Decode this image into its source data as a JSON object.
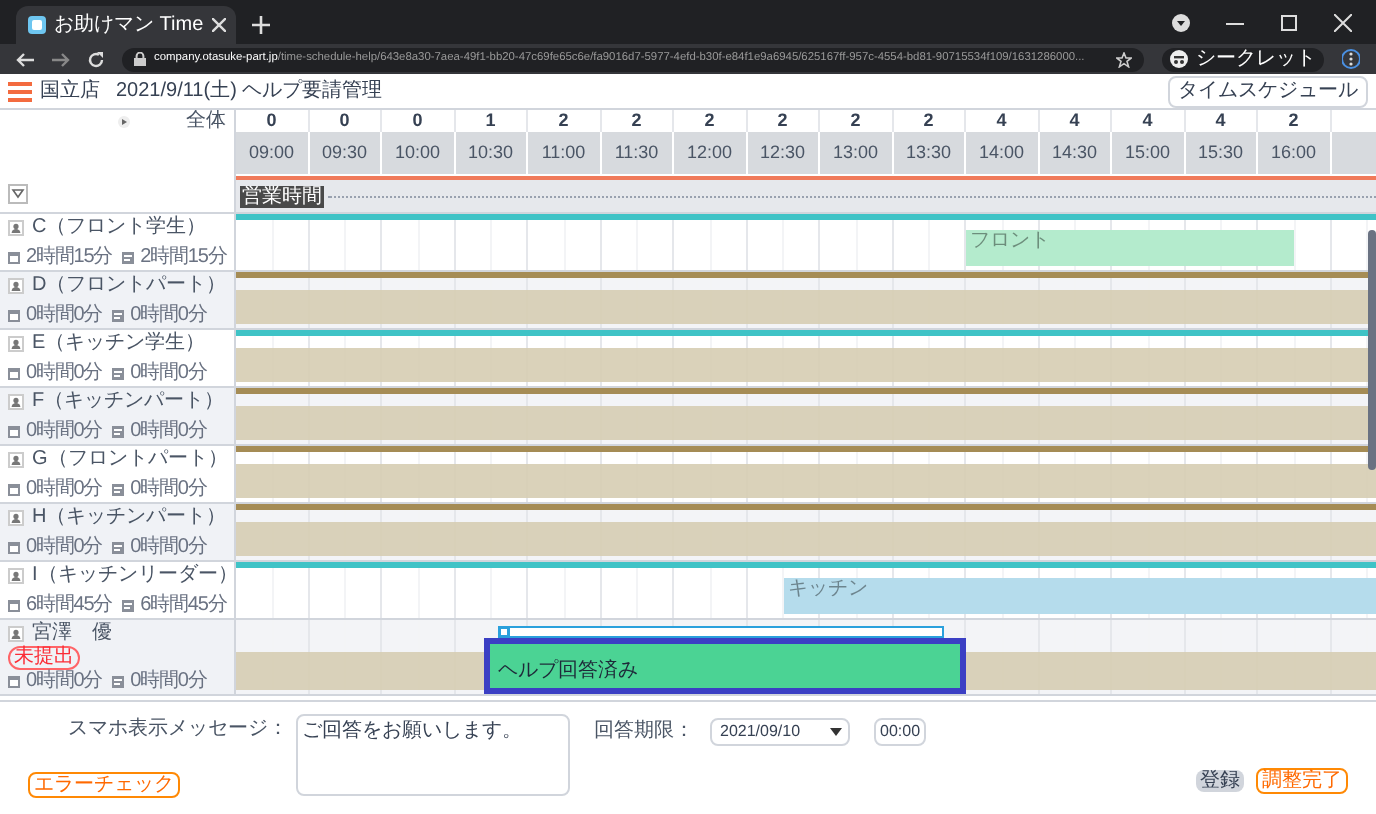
{
  "browser": {
    "tab_title": "お助けマン Time",
    "url_host": "company.otasuke-part.jp",
    "url_path": "/time-schedule-help/643e8a30-7aea-49f1-bb20-47c69fe65c6e/fa9016d7-5977-4efd-b30f-e84f1e9a6945/625167ff-957c-4554-bd81-90715534f109/1631286000...",
    "profile": "シークレット"
  },
  "header": {
    "store": "国立店",
    "title": "2021/9/11(土) ヘルプ要請管理",
    "button": "タイムスケジュール"
  },
  "timeline": {
    "all_label": "全体",
    "band_label": "営業時間",
    "columns": [
      {
        "count": "0",
        "time": "09:00"
      },
      {
        "count": "0",
        "time": "09:30"
      },
      {
        "count": "0",
        "time": "10:00"
      },
      {
        "count": "1",
        "time": "10:30"
      },
      {
        "count": "2",
        "time": "11:00"
      },
      {
        "count": "2",
        "time": "11:30"
      },
      {
        "count": "2",
        "time": "12:00"
      },
      {
        "count": "2",
        "time": "12:30"
      },
      {
        "count": "2",
        "time": "13:00"
      },
      {
        "count": "2",
        "time": "13:30"
      },
      {
        "count": "4",
        "time": "14:00"
      },
      {
        "count": "4",
        "time": "14:30"
      },
      {
        "count": "4",
        "time": "15:00"
      },
      {
        "count": "4",
        "time": "15:30"
      },
      {
        "count": "2",
        "time": "16:00"
      }
    ]
  },
  "staff": [
    {
      "name": "C（フロント学生）",
      "stat_1": "2時間15分",
      "stat_2": "2時間15分",
      "color": "#3fc3c6",
      "band": false,
      "blocks": [
        {
          "label": "フロント",
          "color": "#b4ebcd"
        }
      ]
    },
    {
      "name": "D（フロントパート）",
      "stat_1": "0時間0分",
      "stat_2": "0時間0分",
      "color": "#a58c55",
      "band": true
    },
    {
      "name": "E（キッチン学生）",
      "stat_1": "0時間0分",
      "stat_2": "0時間0分",
      "color": "#3fc3c6",
      "band": true
    },
    {
      "name": "F（キッチンパート）",
      "stat_1": "0時間0分",
      "stat_2": "0時間0分",
      "color": "#a58c55",
      "band": true
    },
    {
      "name": "G（フロントパート）",
      "stat_1": "0時間0分",
      "stat_2": "0時間0分",
      "color": "#a58c55",
      "band": true
    },
    {
      "name": "H（キッチンパート）",
      "stat_1": "0時間0分",
      "stat_2": "0時間0分",
      "color": "#a58c55",
      "band": true
    },
    {
      "name": "I（キッチンリーダー）",
      "stat_1": "6時間45分",
      "stat_2": "6時間45分",
      "color": "#3fc3c6",
      "band": false,
      "blocks": [
        {
          "label": "キッチン",
          "color": "#b5dcec"
        }
      ]
    },
    {
      "name": "宮澤　優",
      "badge": "未提出",
      "stat_1": "0時間0分",
      "stat_2": "0時間0分",
      "band": true,
      "help": {
        "label": "ヘルプ回答済み"
      }
    }
  ],
  "form": {
    "message_label": "スマホ表示メッセージ：",
    "message": "ご回答をお願いします。",
    "deadline_label": "回答期限：",
    "deadline_date": "2021/09/10",
    "deadline_time": "00:00",
    "error_check": "エラーチェック",
    "register": "登録",
    "complete": "調整完了"
  }
}
